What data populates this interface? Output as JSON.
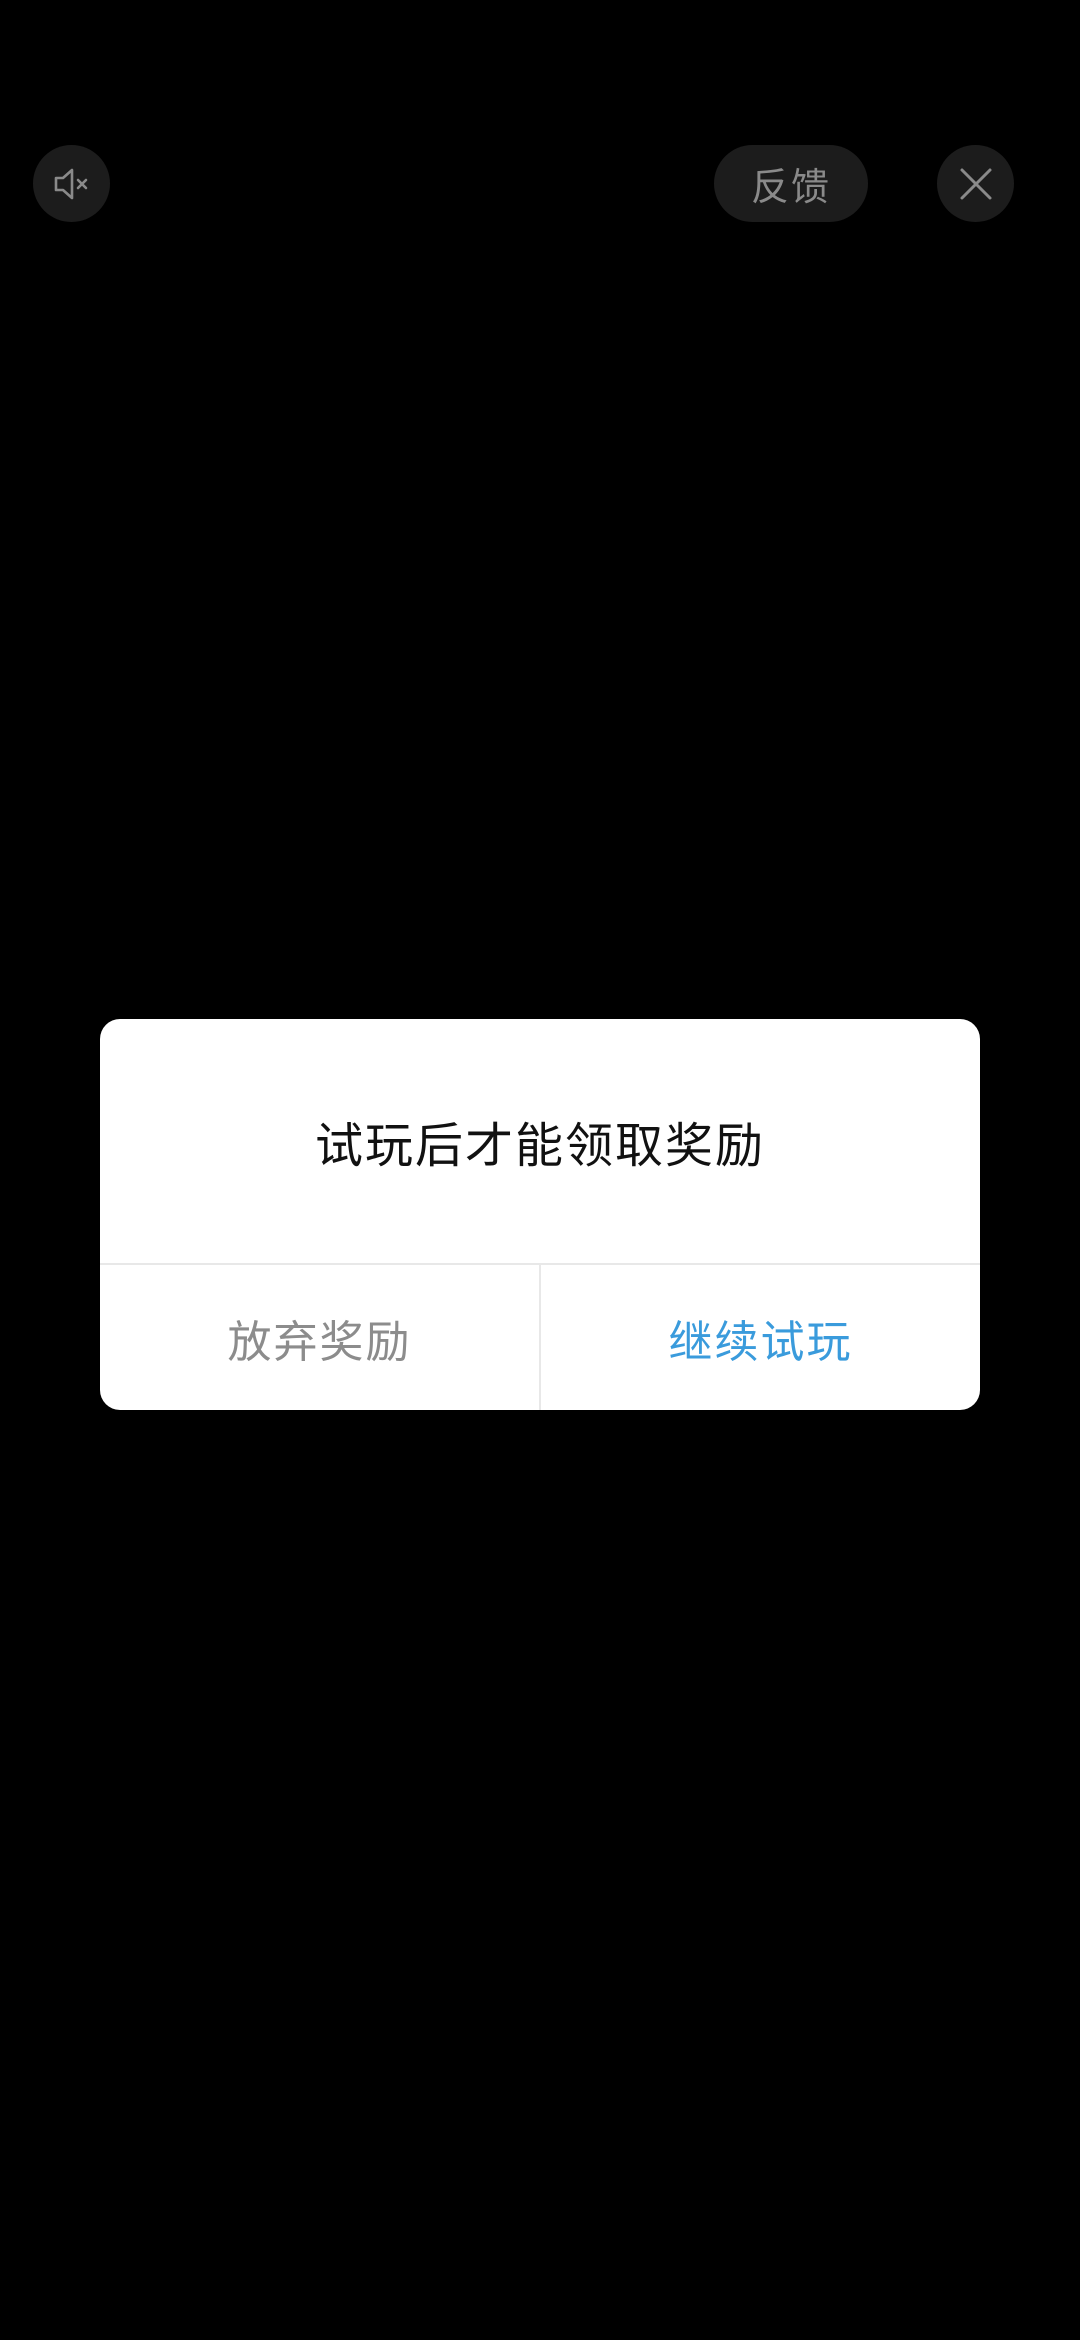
{
  "top_bar": {
    "mute_icon": "speaker-muted-icon",
    "feedback_label": "反馈",
    "close_icon": "close-icon"
  },
  "dialog": {
    "message": "试玩后才能领取奖励",
    "abandon_label": "放弃奖励",
    "continue_label": "继续试玩"
  },
  "colors": {
    "background": "#000000",
    "control_bg": "#1c1c1c",
    "control_fg": "#8a8a8a",
    "dialog_bg": "#ffffff",
    "accent": "#3a9bdc",
    "secondary_text": "#8c8c8c"
  }
}
